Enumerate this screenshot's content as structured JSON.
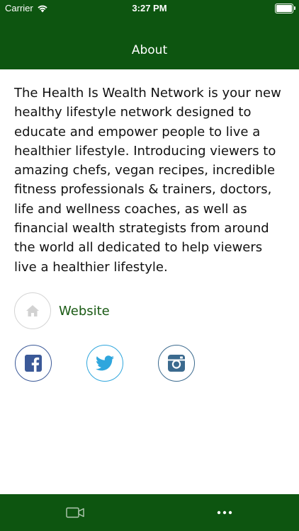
{
  "status_bar": {
    "carrier": "Carrier",
    "time": "3:27 PM",
    "battery_level": 1.0
  },
  "nav": {
    "title": "About"
  },
  "about": {
    "text": "The Health Is Wealth Network is your new healthy lifestyle network designed to educate and empower people to live a healthier lifestyle. Introducing viewers to amazing chefs, vegan recipes, incredible fitness professionals & trainers, doctors, life and wellness coaches, as well as financial wealth strategists from around the world all dedicated to help viewers live a healthier lifestyle."
  },
  "website": {
    "label": "Website",
    "icon": "home-icon"
  },
  "social": [
    {
      "name": "facebook",
      "icon": "facebook-icon",
      "color": "#3b5998"
    },
    {
      "name": "twitter",
      "icon": "twitter-icon",
      "color": "#2fa6dd"
    },
    {
      "name": "instagram",
      "icon": "instagram-icon",
      "color": "#3b6a8e"
    }
  ],
  "tab_bar": {
    "items": [
      {
        "name": "videos",
        "icon": "video-camera-icon"
      },
      {
        "name": "more",
        "icon": "more-dots-icon"
      }
    ]
  },
  "colors": {
    "brand_green": "#0d5510",
    "link_green": "#1a5a14",
    "white": "#ffffff"
  }
}
